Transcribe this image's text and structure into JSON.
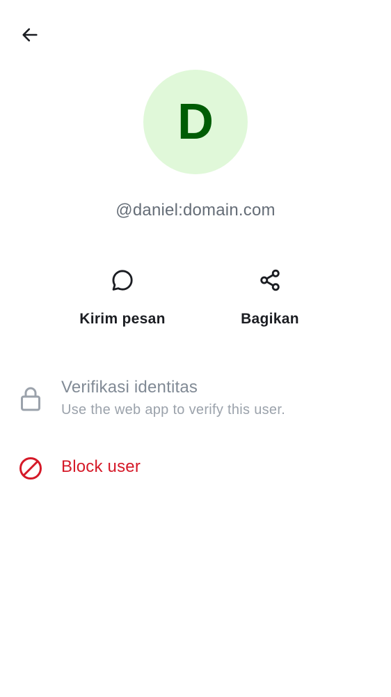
{
  "header": {
    "back_icon": "arrow-left-icon"
  },
  "profile": {
    "avatar_initial": "D",
    "user_id": "@daniel:domain.com",
    "avatar_bg": "#e0f8d9",
    "avatar_fg": "#005c05"
  },
  "actions": {
    "send_message": {
      "label": "Kirim pesan",
      "icon": "chat-bubble-icon"
    },
    "share": {
      "label": "Bagikan",
      "icon": "share-icon"
    }
  },
  "verify": {
    "icon": "lock-icon",
    "title": "Verifikasi identitas",
    "subtitle": "Use the web app to verify this user."
  },
  "block": {
    "icon": "block-icon",
    "label": "Block user",
    "color": "#d51928"
  }
}
